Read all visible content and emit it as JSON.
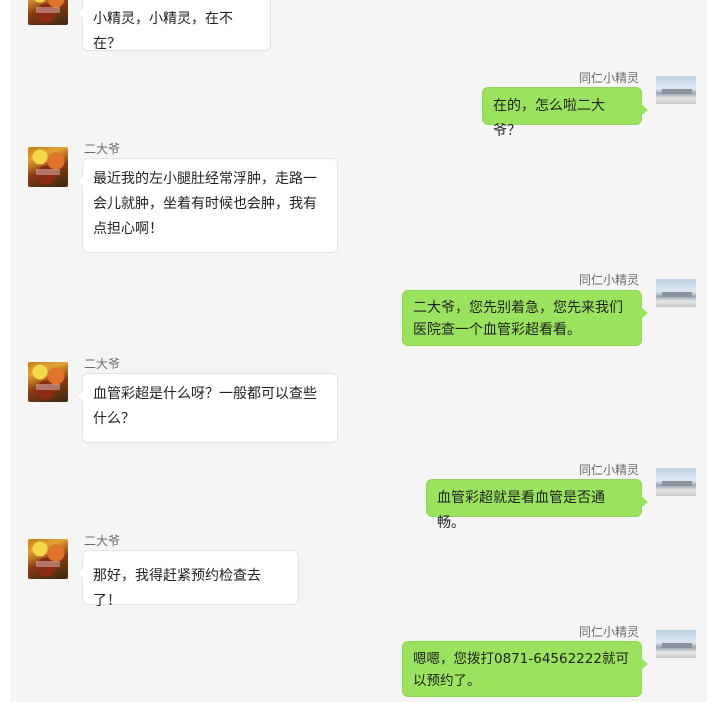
{
  "messages": [
    {
      "side": "left",
      "name": "",
      "text": "小精灵，小精灵，在不在？"
    },
    {
      "side": "right",
      "name": "同仁小精灵",
      "text": "在的，怎么啦二大爷？"
    },
    {
      "side": "left",
      "name": "二大爷",
      "text": "最近我的左小腿肚经常浮肿，走路一会儿就肿，坐着有时候也会肿，我有点担心啊！"
    },
    {
      "side": "right",
      "name": "同仁小精灵",
      "text": "二大爷，您先别着急，您先来我们医院查一个血管彩超看看。"
    },
    {
      "side": "left",
      "name": "二大爷",
      "text": "血管彩超是什么呀？一般都可以查些什么？"
    },
    {
      "side": "right",
      "name": "同仁小精灵",
      "text": "血管彩超就是看血管是否通畅。"
    },
    {
      "side": "left",
      "name": "二大爷",
      "text": "那好，我得赶紧预约检查去了！"
    },
    {
      "side": "right",
      "name": "同仁小精灵",
      "text": "嗯嗯，您拨打0871-64562222就可以预约了。"
    }
  ]
}
